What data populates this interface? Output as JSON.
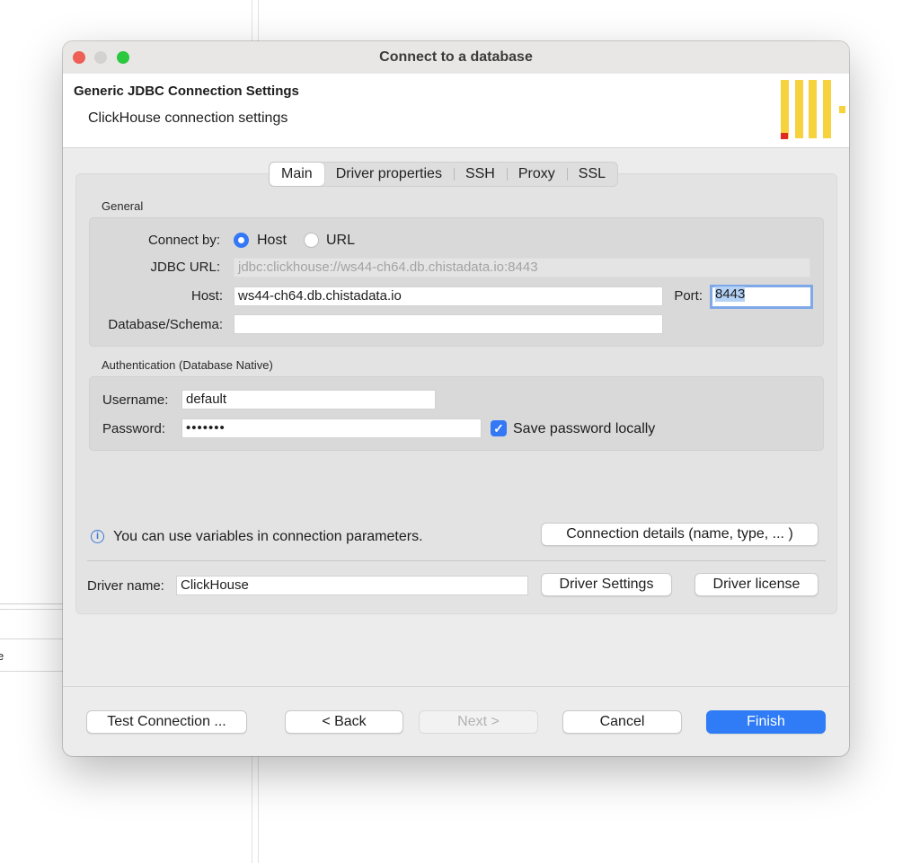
{
  "window": {
    "title": "Connect to a database"
  },
  "header": {
    "title": "Generic JDBC Connection Settings",
    "subtitle": "ClickHouse connection settings",
    "logo_colors": {
      "bars": "#f6d23d",
      "accent": "#e02b20"
    }
  },
  "tabs": [
    {
      "label": "Main",
      "active": true
    },
    {
      "label": "Driver properties",
      "active": false
    },
    {
      "label": "SSH",
      "active": false
    },
    {
      "label": "Proxy",
      "active": false
    },
    {
      "label": "SSL",
      "active": false
    }
  ],
  "general": {
    "section_label": "General",
    "connect_by_label": "Connect by:",
    "connect_by_options": [
      "Host",
      "URL"
    ],
    "connect_by_selected": "Host",
    "jdbc_url_label": "JDBC URL:",
    "jdbc_url_value": "jdbc:clickhouse://ws44-ch64.db.chistadata.io:8443",
    "host_label": "Host:",
    "host_value": "ws44-ch64.db.chistadata.io",
    "port_label": "Port:",
    "port_value": "8443",
    "database_label": "Database/Schema:",
    "database_value": ""
  },
  "auth": {
    "section_label": "Authentication (Database Native)",
    "username_label": "Username:",
    "username_value": "default",
    "password_label": "Password:",
    "password_value": "•••••••",
    "save_password_label": "Save password locally",
    "save_password_checked": true
  },
  "info": {
    "icon": "info-icon",
    "text": "You can use variables in connection parameters.",
    "details_button": "Connection details (name, type, ... )"
  },
  "driver": {
    "name_label": "Driver name:",
    "name_value": "ClickHouse",
    "settings_button": "Driver Settings",
    "license_button": "Driver license"
  },
  "footer": {
    "test_button": "Test Connection ...",
    "back_button": "< Back",
    "next_button": "Next >",
    "cancel_button": "Cancel",
    "finish_button": "Finish"
  },
  "background": {
    "fragment_text": "e"
  },
  "colors": {
    "accent": "#2f7cf6",
    "focus_ring": "#7fa8e8"
  }
}
